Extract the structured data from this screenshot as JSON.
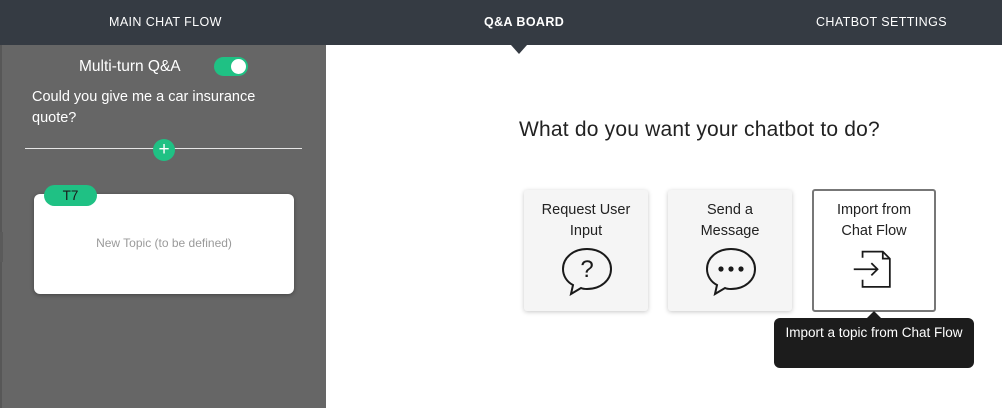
{
  "nav": {
    "tabs": [
      {
        "label": "MAIN CHAT FLOW"
      },
      {
        "label": "Q&A BOARD"
      },
      {
        "label": "CHATBOT SETTINGS"
      }
    ]
  },
  "sidebar": {
    "multiturn_label": "Multi-turn Q&A",
    "multiturn_enabled": true,
    "question": "Could you give me a car insurance quote?",
    "add_icon": "+",
    "topic": {
      "badge": "T7",
      "text": "New Topic (to be defined)"
    }
  },
  "main": {
    "title": "What do you want your chatbot to do?",
    "cards": [
      {
        "label": "Request User Input",
        "icon": "question-bubble-icon"
      },
      {
        "label": "Send a Message",
        "icon": "ellipsis-bubble-icon"
      },
      {
        "label": "Import from Chat Flow",
        "icon": "import-file-icon"
      }
    ],
    "tooltip": "Import a topic from Chat Flow"
  },
  "colors": {
    "nav_bg": "#353b43",
    "sidebar_bg": "#666666",
    "accent": "#1fc184",
    "tooltip_bg": "#1c1c1c"
  }
}
